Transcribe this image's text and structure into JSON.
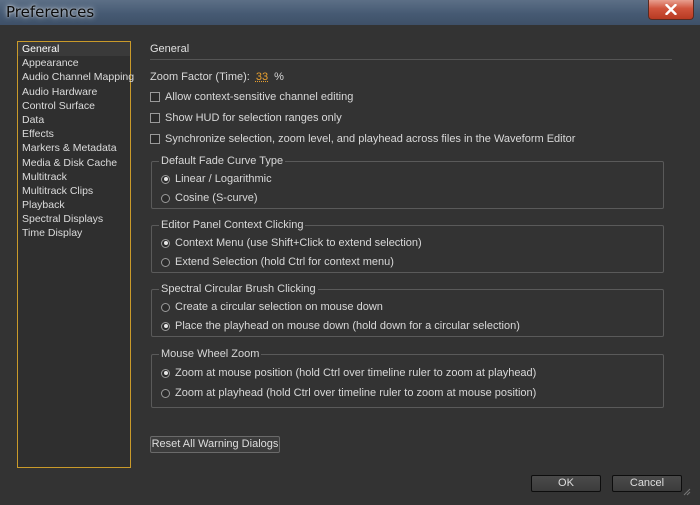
{
  "window": {
    "title": "Preferences"
  },
  "sidebar": {
    "items": [
      {
        "label": "General",
        "selected": true
      },
      {
        "label": "Appearance"
      },
      {
        "label": "Audio Channel Mapping"
      },
      {
        "label": "Audio Hardware"
      },
      {
        "label": "Control Surface"
      },
      {
        "label": "Data"
      },
      {
        "label": "Effects"
      },
      {
        "label": "Markers & Metadata"
      },
      {
        "label": "Media & Disk Cache"
      },
      {
        "label": "Multitrack"
      },
      {
        "label": "Multitrack Clips"
      },
      {
        "label": "Playback"
      },
      {
        "label": "Spectral Displays"
      },
      {
        "label": "Time Display"
      }
    ]
  },
  "general": {
    "heading": "General",
    "zoom_label": "Zoom Factor (Time):",
    "zoom_value": "33",
    "zoom_unit": "%",
    "checkboxes": [
      {
        "label": "Allow context-sensitive channel editing",
        "checked": false
      },
      {
        "label": "Show HUD for selection ranges only",
        "checked": false
      },
      {
        "label": "Synchronize selection, zoom level, and playhead across files in the Waveform Editor",
        "checked": false
      }
    ],
    "groups": [
      {
        "title": "Default Fade Curve Type",
        "options": [
          {
            "label": "Linear / Logarithmic",
            "selected": true
          },
          {
            "label": "Cosine (S-curve)",
            "selected": false
          }
        ]
      },
      {
        "title": "Editor Panel Context Clicking",
        "options": [
          {
            "label": "Context Menu (use Shift+Click to extend selection)",
            "selected": true
          },
          {
            "label": "Extend Selection (hold Ctrl for context menu)",
            "selected": false
          }
        ]
      },
      {
        "title": "Spectral Circular Brush Clicking",
        "options": [
          {
            "label": "Create a circular selection on mouse down",
            "selected": false
          },
          {
            "label": "Place the playhead on mouse down (hold down for a circular selection)",
            "selected": true
          }
        ]
      },
      {
        "title": "Mouse Wheel Zoom",
        "options": [
          {
            "label": "Zoom at mouse position (hold Ctrl over timeline ruler to zoom at playhead)",
            "selected": true
          },
          {
            "label": "Zoom at playhead (hold Ctrl over timeline ruler to zoom at mouse position)",
            "selected": false
          }
        ]
      }
    ],
    "reset_button": "Reset All Warning Dialogs"
  },
  "footer": {
    "ok": "OK",
    "cancel": "Cancel"
  },
  "colors": {
    "accent": "#e8a030",
    "selection_border": "#c99a2a",
    "close_button": "#c84a32"
  }
}
